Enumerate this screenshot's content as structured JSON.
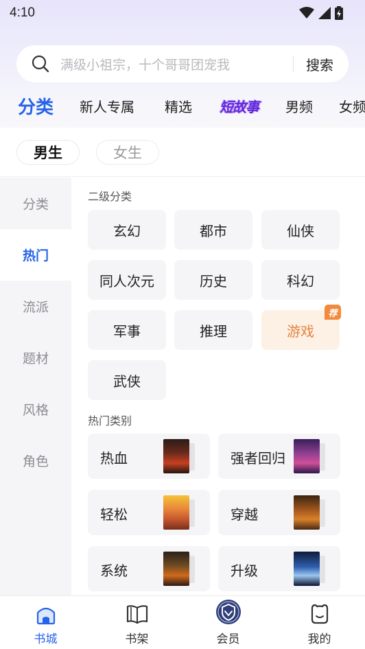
{
  "status_bar": {
    "time": "4:10"
  },
  "search": {
    "placeholder": "满级小祖宗，十个哥哥团宠我",
    "button_label": "搜索"
  },
  "top_tabs": [
    {
      "label": "分类",
      "active": true
    },
    {
      "label": "新人专属"
    },
    {
      "label": "精选"
    },
    {
      "label": "短故事"
    },
    {
      "label": "男频"
    },
    {
      "label": "女频"
    }
  ],
  "gender": {
    "male": "男生",
    "female": "女生",
    "selected": "男生"
  },
  "sidebar": [
    {
      "label": "分类"
    },
    {
      "label": "热门",
      "active": true
    },
    {
      "label": "流派"
    },
    {
      "label": "题材"
    },
    {
      "label": "风格"
    },
    {
      "label": "角色"
    }
  ],
  "secondary": {
    "title": "二级分类",
    "items": [
      "玄幻",
      "都市",
      "仙侠",
      "同人次元",
      "历史",
      "科幻",
      "军事",
      "推理",
      "游戏",
      "武侠"
    ],
    "recommend_badge": "荐"
  },
  "hot": {
    "title": "热门类别",
    "items": [
      "热血",
      "强者回归",
      "轻松",
      "穿越",
      "系统",
      "升级"
    ]
  },
  "bottom_nav": [
    {
      "label": "书城",
      "icon": "bookstore-icon",
      "active": true
    },
    {
      "label": "书架",
      "icon": "bookshelf-icon"
    },
    {
      "label": "会员",
      "icon": "vip-shield-icon"
    },
    {
      "label": "我的",
      "icon": "profile-icon"
    }
  ],
  "colors": {
    "accent": "#2563e8",
    "highlight_bg": "#fdf1e5",
    "highlight_text": "#e5823f",
    "badge": "#f3893c"
  }
}
